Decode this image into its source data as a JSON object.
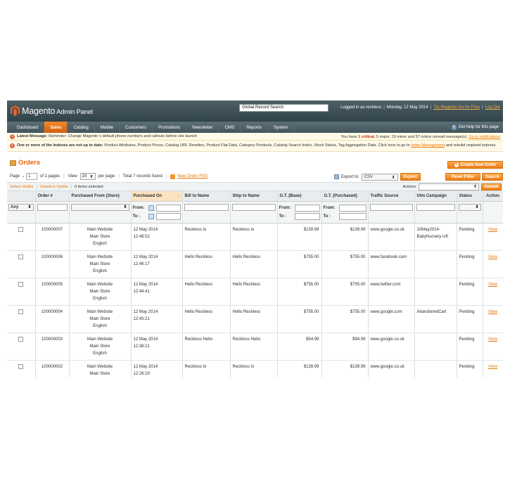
{
  "header": {
    "logo_brand": "Magento",
    "logo_sub": "Admin Panel",
    "search_value": "Global Record Search",
    "logged_in": "Logged in as reckless",
    "date": "Monday, 12 May 2014",
    "go_fresh": "Try Magento Go for Free",
    "logout": "Log Out"
  },
  "nav": {
    "items": [
      "Dashboard",
      "Sales",
      "Catalog",
      "Mobile",
      "Customers",
      "Promotions",
      "Newsletter",
      "CMS",
      "Reports",
      "System"
    ],
    "active": "Sales",
    "help": "Get help for this page"
  },
  "messages": {
    "latest_label": "Latest Message:",
    "latest_text": "Reminder: Change Magento`s default phone numbers and callouts before site launch",
    "notice_prefix": "You have",
    "critical_count": "1 critical",
    "notice_rest": ", 5 major, 19 minor and 57 notice unread message(s).",
    "notice_link": "Go to notifications",
    "index_bold": "One or more of the Indexes are not up to date:",
    "index_text": "Product Attributes, Product Prices, Catalog URL Rewrites, Product Flat Data, Category Products, Catalog Search Index, Stock Status, Tag Aggregation Data. Click here to go to",
    "index_link": "Index Management",
    "index_tail": "and rebuild required indexes."
  },
  "page": {
    "title": "Orders",
    "create_button": "Create New Order"
  },
  "pager": {
    "page_label": "Page",
    "page_value": "1",
    "of_pages": "of 1 pages",
    "view_label": "View",
    "per_page_value": "20",
    "per_page_label": "per page",
    "total": "Total 7 records found",
    "rss": "New Order RSS",
    "export_label": "Export to:",
    "export_value": "CSV",
    "export_button": "Export",
    "reset_button": "Reset Filter",
    "search_button": "Search"
  },
  "massaction": {
    "select_visible": "Select Visible",
    "unselect_visible": "Unselect Visible",
    "selected": "0 items selected",
    "actions_label": "Actions",
    "submit": "Submit"
  },
  "grid": {
    "columns": [
      "",
      "Order #",
      "Purchased From (Store)",
      "Purchased On",
      "Bill to Name",
      "Ship to Name",
      "G.T. (Base)",
      "G.T. (Purchased)",
      "Traffic Source",
      "Utm Campaign",
      "Status",
      "Action"
    ],
    "filter": {
      "any": "Any",
      "from": "From:",
      "to": "To :"
    },
    "rows": [
      {
        "order": "100000007",
        "store": [
          "Main Website",
          "Main Store",
          "English"
        ],
        "date": [
          "12 May 2014",
          "12:48:52"
        ],
        "bill": "Reckless lo",
        "ship": "Reckless lo",
        "base": "$139.99",
        "purchased": "$139.99",
        "source": "www.google.co.uk",
        "campaign": "10May2014-BabyNursery-UK",
        "status": "Pending",
        "action": "View"
      },
      {
        "order": "100000006",
        "store": [
          "Main Website",
          "Main Store",
          "English"
        ],
        "date": [
          "12 May 2014",
          "12:46:17"
        ],
        "bill": "Hello Reckless",
        "ship": "Hello Reckless",
        "base": "$755.00",
        "purchased": "$755.00",
        "source": "www.facebook.com",
        "campaign": "",
        "status": "Pending",
        "action": "View"
      },
      {
        "order": "100000005",
        "store": [
          "Main Website",
          "Main Store",
          "English"
        ],
        "date": [
          "12 May 2014",
          "12:44:41"
        ],
        "bill": "Hello Reckless",
        "ship": "Hello Reckless",
        "base": "$755.00",
        "purchased": "$755.00",
        "source": "www.twitter.com",
        "campaign": "",
        "status": "Pending",
        "action": "View"
      },
      {
        "order": "100000004",
        "store": [
          "Main Website",
          "Main Store",
          "English"
        ],
        "date": [
          "12 May 2014",
          "12:43:21"
        ],
        "bill": "Hello Reckless",
        "ship": "Hello Reckless",
        "base": "$755.00",
        "purchased": "$755.00",
        "source": "www.google.com",
        "campaign": "AbandonedCart",
        "status": "Pending",
        "action": "View"
      },
      {
        "order": "100000003",
        "store": [
          "Main Website",
          "Main Store",
          "English"
        ],
        "date": [
          "12 May 2014",
          "12:38:21"
        ],
        "bill": "Reckless Hello",
        "ship": "Reckless Hello",
        "base": "$94.99",
        "purchased": "$94.99",
        "source": "www.google.co.uk",
        "campaign": "",
        "status": "Pending",
        "action": "View"
      },
      {
        "order": "100000002",
        "store": [
          "Main Website",
          "Main Store",
          "English"
        ],
        "date": [
          "12 May 2014",
          "12:26:19"
        ],
        "bill": "Reckless lo",
        "ship": "Reckless lo",
        "base": "$139.99",
        "purchased": "$139.99",
        "source": "www.google.co.uk",
        "campaign": "",
        "status": "Pending",
        "action": "View"
      }
    ]
  },
  "colors": {
    "accent": "#ea7601",
    "header": "#3d4f56",
    "nav_active": "#e5731b"
  }
}
